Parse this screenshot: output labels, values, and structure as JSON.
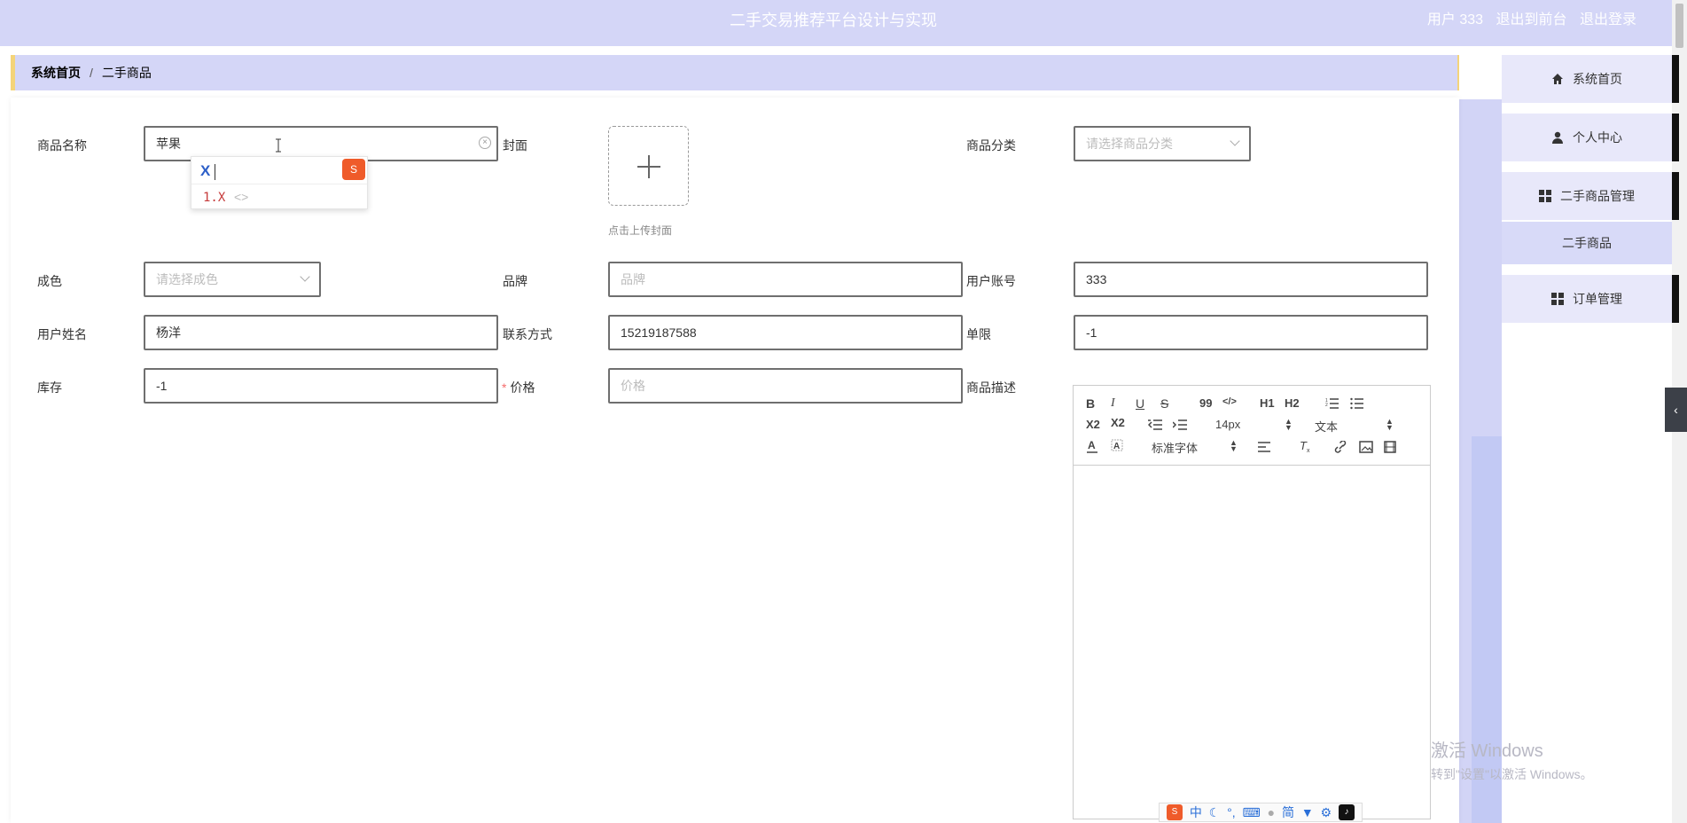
{
  "header": {
    "title": "二手交易推荐平台设计与实现",
    "user_label": "用户 333",
    "back_to_front": "退出到前台",
    "logout": "退出登录"
  },
  "breadcrumb": {
    "home": "系统首页",
    "separator": "/",
    "current": "二手商品"
  },
  "form": {
    "name_label": "商品名称",
    "name_value": "苹果",
    "cover_label": "封面",
    "cover_tip": "点击上传封面",
    "category_label": "商品分类",
    "category_placeholder": "请选择商品分类",
    "condition_label": "成色",
    "condition_placeholder": "请选择成色",
    "brand_label": "品牌",
    "brand_placeholder": "品牌",
    "account_label": "用户账号",
    "account_value": "333",
    "username_label": "用户姓名",
    "username_value": "杨洋",
    "contact_label": "联系方式",
    "contact_value": "15219187588",
    "limit_label": "单限",
    "limit_value": "-1",
    "stock_label": "库存",
    "stock_value": "-1",
    "price_required": "*",
    "price_label": "价格",
    "price_placeholder": "价格",
    "desc_label": "商品描述"
  },
  "ime_popup": {
    "composition": "X",
    "candidate": "1.X",
    "nav": "<>"
  },
  "editor": {
    "bold": "B",
    "italic": "I",
    "underline": "U",
    "strike": "S",
    "quote": "99",
    "code": "</>",
    "h1": "H1",
    "h2": "H2",
    "sub": "X2",
    "sup": "X2",
    "font_size": "14px",
    "text_type": "文本",
    "font_family": "标准字体"
  },
  "sidebar": {
    "items": [
      {
        "label": "系统首页",
        "icon": "home-icon"
      },
      {
        "label": "个人中心",
        "icon": "user-icon"
      },
      {
        "label": "二手商品管理",
        "icon": "grid-icon"
      },
      {
        "label": "二手商品",
        "icon": ""
      },
      {
        "label": "订单管理",
        "icon": "grid-icon"
      }
    ]
  },
  "watermark": {
    "line1": "激活 Windows",
    "line2": "转到\"设置\"以激活 Windows。"
  },
  "ime_status": {
    "items": [
      "中",
      "简"
    ]
  }
}
